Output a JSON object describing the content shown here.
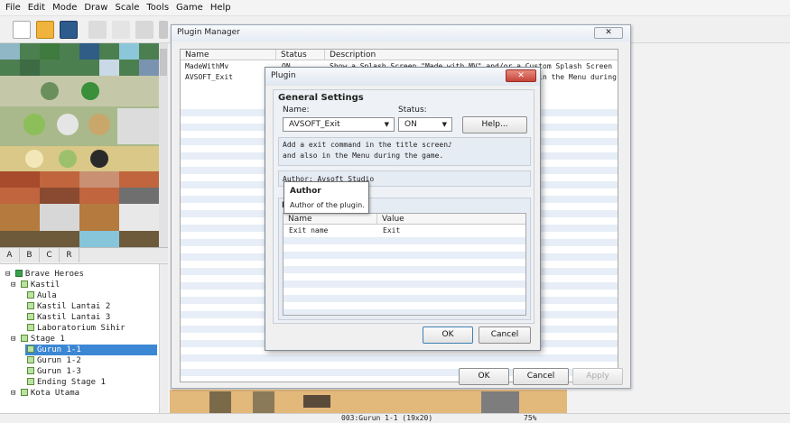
{
  "menubar": {
    "items": [
      "File",
      "Edit",
      "Mode",
      "Draw",
      "Scale",
      "Tools",
      "Game",
      "Help"
    ]
  },
  "tileset_tabs": [
    "A",
    "B",
    "C",
    "R"
  ],
  "map_tree": {
    "items": [
      {
        "label": "Brave Heroes",
        "kind": "project"
      },
      {
        "label": "Kastil",
        "kind": "map"
      },
      {
        "label": "Aula",
        "kind": "map"
      },
      {
        "label": "Kastil Lantai 2",
        "kind": "map"
      },
      {
        "label": "Kastil Lantai 3",
        "kind": "map"
      },
      {
        "label": "Laboratorium Sihir",
        "kind": "map"
      },
      {
        "label": "Stage 1",
        "kind": "map"
      },
      {
        "label": "Gurun 1-1",
        "kind": "map",
        "selected": true
      },
      {
        "label": "Gurun 1-2",
        "kind": "map"
      },
      {
        "label": "Gurun 1-3",
        "kind": "map"
      },
      {
        "label": "Ending Stage 1",
        "kind": "map"
      },
      {
        "label": "Kota Utama",
        "kind": "map"
      }
    ]
  },
  "status_bar": {
    "map_info": "003:Gurun 1-1 (19x20)",
    "zoom": "75%"
  },
  "plugin_manager": {
    "title": "Plugin Manager",
    "columns": [
      "Name",
      "Status",
      "Description"
    ],
    "rows": [
      {
        "name": "MadeWithMv",
        "status": "ON",
        "description": "Show a Splash Screen \"Made with MV\" and/or a Custom Splash Screen be⋯"
      },
      {
        "name": "AVSOFT_Exit",
        "status": "ON",
        "description": "Add a exit command in the title screen and also in the Menu during ⋯"
      }
    ],
    "ok_label": "OK",
    "cancel_label": "Cancel",
    "apply_label": "Apply"
  },
  "plugin_dialog": {
    "title": "Plugin",
    "section_title": "General Settings",
    "name_label": "Name:",
    "name_value": "AVSOFT_Exit",
    "status_label": "Status:",
    "status_value": "ON",
    "help_label": "Help...",
    "description_line1": "Add a exit command in the title screen♪",
    "description_line2": "and also in the Menu during the game.",
    "author_text": "Author: Avsoft Studio",
    "params_label": "Pa",
    "param_columns": [
      "Name",
      "Value"
    ],
    "params": [
      {
        "name": "Exit name",
        "value": "Exit"
      }
    ],
    "ok_label": "OK",
    "cancel_label": "Cancel"
  },
  "tooltip": {
    "title": "Author",
    "text": "Author of the plugin."
  }
}
